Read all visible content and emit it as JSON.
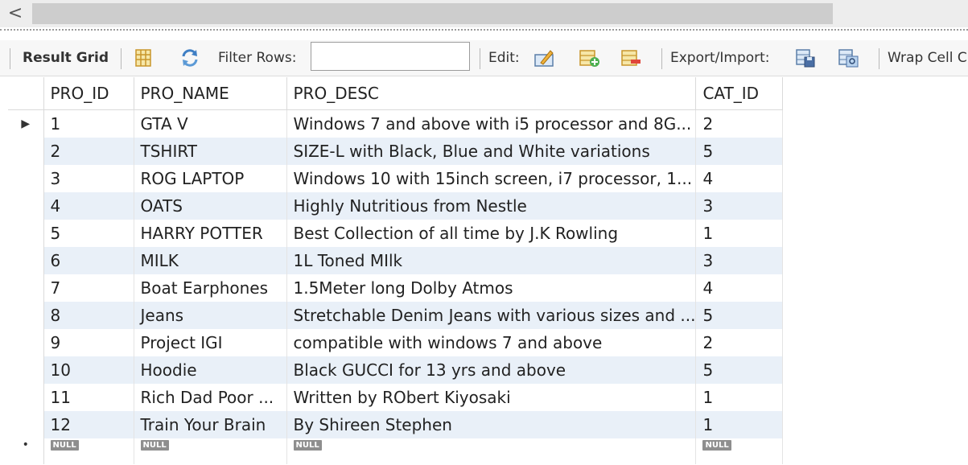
{
  "scrollbar": {
    "left_arrow": "<"
  },
  "toolbar": {
    "result_grid": "Result Grid",
    "filter_rows": "Filter Rows:",
    "filter_value": "",
    "edit": "Edit:",
    "export_import": "Export/Import:",
    "wrap_cell": "Wrap Cell C"
  },
  "grid": {
    "columns": [
      "PRO_ID",
      "PRO_NAME",
      "PRO_DESC",
      "CAT_ID"
    ],
    "rows": [
      [
        "1",
        "GTA V",
        "Windows 7 and above with i5 processor and 8G...",
        "2"
      ],
      [
        "2",
        "TSHIRT",
        "SIZE-L with Black, Blue and White variations",
        "5"
      ],
      [
        "3",
        "ROG LAPTOP",
        "Windows 10 with 15inch screen, i7 processor, 1...",
        "4"
      ],
      [
        "4",
        "OATS",
        "Highly Nutritious from Nestle",
        "3"
      ],
      [
        "5",
        "HARRY POTTER",
        "Best Collection of all time by J.K Rowling",
        "1"
      ],
      [
        "6",
        "MILK",
        "1L Toned MIlk",
        "3"
      ],
      [
        "7",
        "Boat Earphones",
        "1.5Meter long Dolby Atmos",
        "4"
      ],
      [
        "8",
        "Jeans",
        "Stretchable Denim Jeans with various sizes and ...",
        "5"
      ],
      [
        "9",
        "Project IGI",
        "compatible with windows 7 and above",
        "2"
      ],
      [
        "10",
        "Hoodie",
        "Black GUCCI for 13 yrs and above",
        "5"
      ],
      [
        "11",
        "Rich Dad Poor ...",
        "Written by RObert Kiyosaki",
        "1"
      ],
      [
        "12",
        "Train Your Brain",
        "By Shireen Stephen",
        "1"
      ]
    ],
    "null_label": "NULL",
    "current_row_marker": "▶",
    "new_row_marker": "•"
  }
}
